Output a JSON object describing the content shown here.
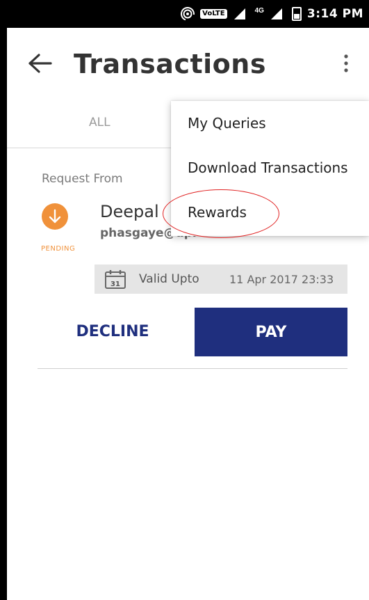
{
  "status_bar": {
    "network_badge": "VoLTE",
    "network_type": "4G",
    "time": "3:14 PM"
  },
  "toolbar": {
    "title": "Transactions",
    "back_icon": "arrow-left-icon",
    "more_icon": "more-vert-icon"
  },
  "tabs": [
    {
      "label": "ALL"
    }
  ],
  "request": {
    "label": "Request From",
    "status": "PENDING",
    "status_icon": "arrow-down-icon",
    "payer_name": "Deepal",
    "payer_vpa": "phasgaye@upi",
    "valid_label": "Valid Upto",
    "valid_date": "11 Apr 2017 23:33",
    "calendar_day": "31",
    "decline_label": "DECLINE",
    "pay_label": "PAY"
  },
  "menu": {
    "items": [
      {
        "label": "My Queries"
      },
      {
        "label": "Download Transactions"
      },
      {
        "label": "Rewards"
      }
    ]
  },
  "colors": {
    "primary": "#1f2f7e",
    "pending": "#f0913a",
    "annotation": "#e02020"
  }
}
